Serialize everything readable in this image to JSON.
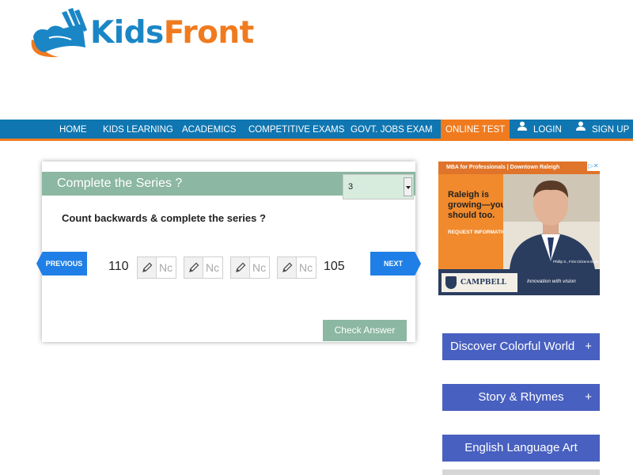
{
  "logo": {
    "text_part1": "Kids",
    "text_part2": "Front"
  },
  "nav": {
    "items": [
      {
        "label": "HOME"
      },
      {
        "label": "KIDS LEARNING"
      },
      {
        "label": "ACADEMICS"
      },
      {
        "label": "COMPETITIVE EXAMS"
      },
      {
        "label": "GOVT. JOBS EXAM"
      },
      {
        "label": "ONLINE TEST",
        "active": true
      },
      {
        "label": "LOGIN",
        "icon": "user-icon"
      },
      {
        "label": "SIGN UP",
        "icon": "user-icon"
      }
    ],
    "active_color": "#f07b1f",
    "bar_color": "#0f76b1"
  },
  "quiz": {
    "title": "Complete the Series ?",
    "level_selected": "3",
    "question": "Count backwards & complete the series ?",
    "prev_label": "PREVIOUS",
    "next_label": "NEXT",
    "series_start": "110",
    "series_end": "105",
    "answer_placeholder": "Nc",
    "check_label": "Check Answer",
    "header_color": "#8cb7a2"
  },
  "ad": {
    "top_line": "MBA for Professionals | Downtown Raleigh",
    "headline": "Raleigh is growing—you should too.",
    "request": "REQUEST INFORMATION",
    "logo_text": "CAMPBELL",
    "tagline": "Innovation with vision",
    "caption": "Phillip S., First Citizens Bank"
  },
  "sidebar": {
    "buttons": [
      {
        "label": "Discover Colorful World",
        "plus": "+"
      },
      {
        "label": "Story & Rhymes",
        "plus": "+"
      },
      {
        "label": "English Language Art"
      }
    ],
    "button_color": "#4860c0"
  }
}
